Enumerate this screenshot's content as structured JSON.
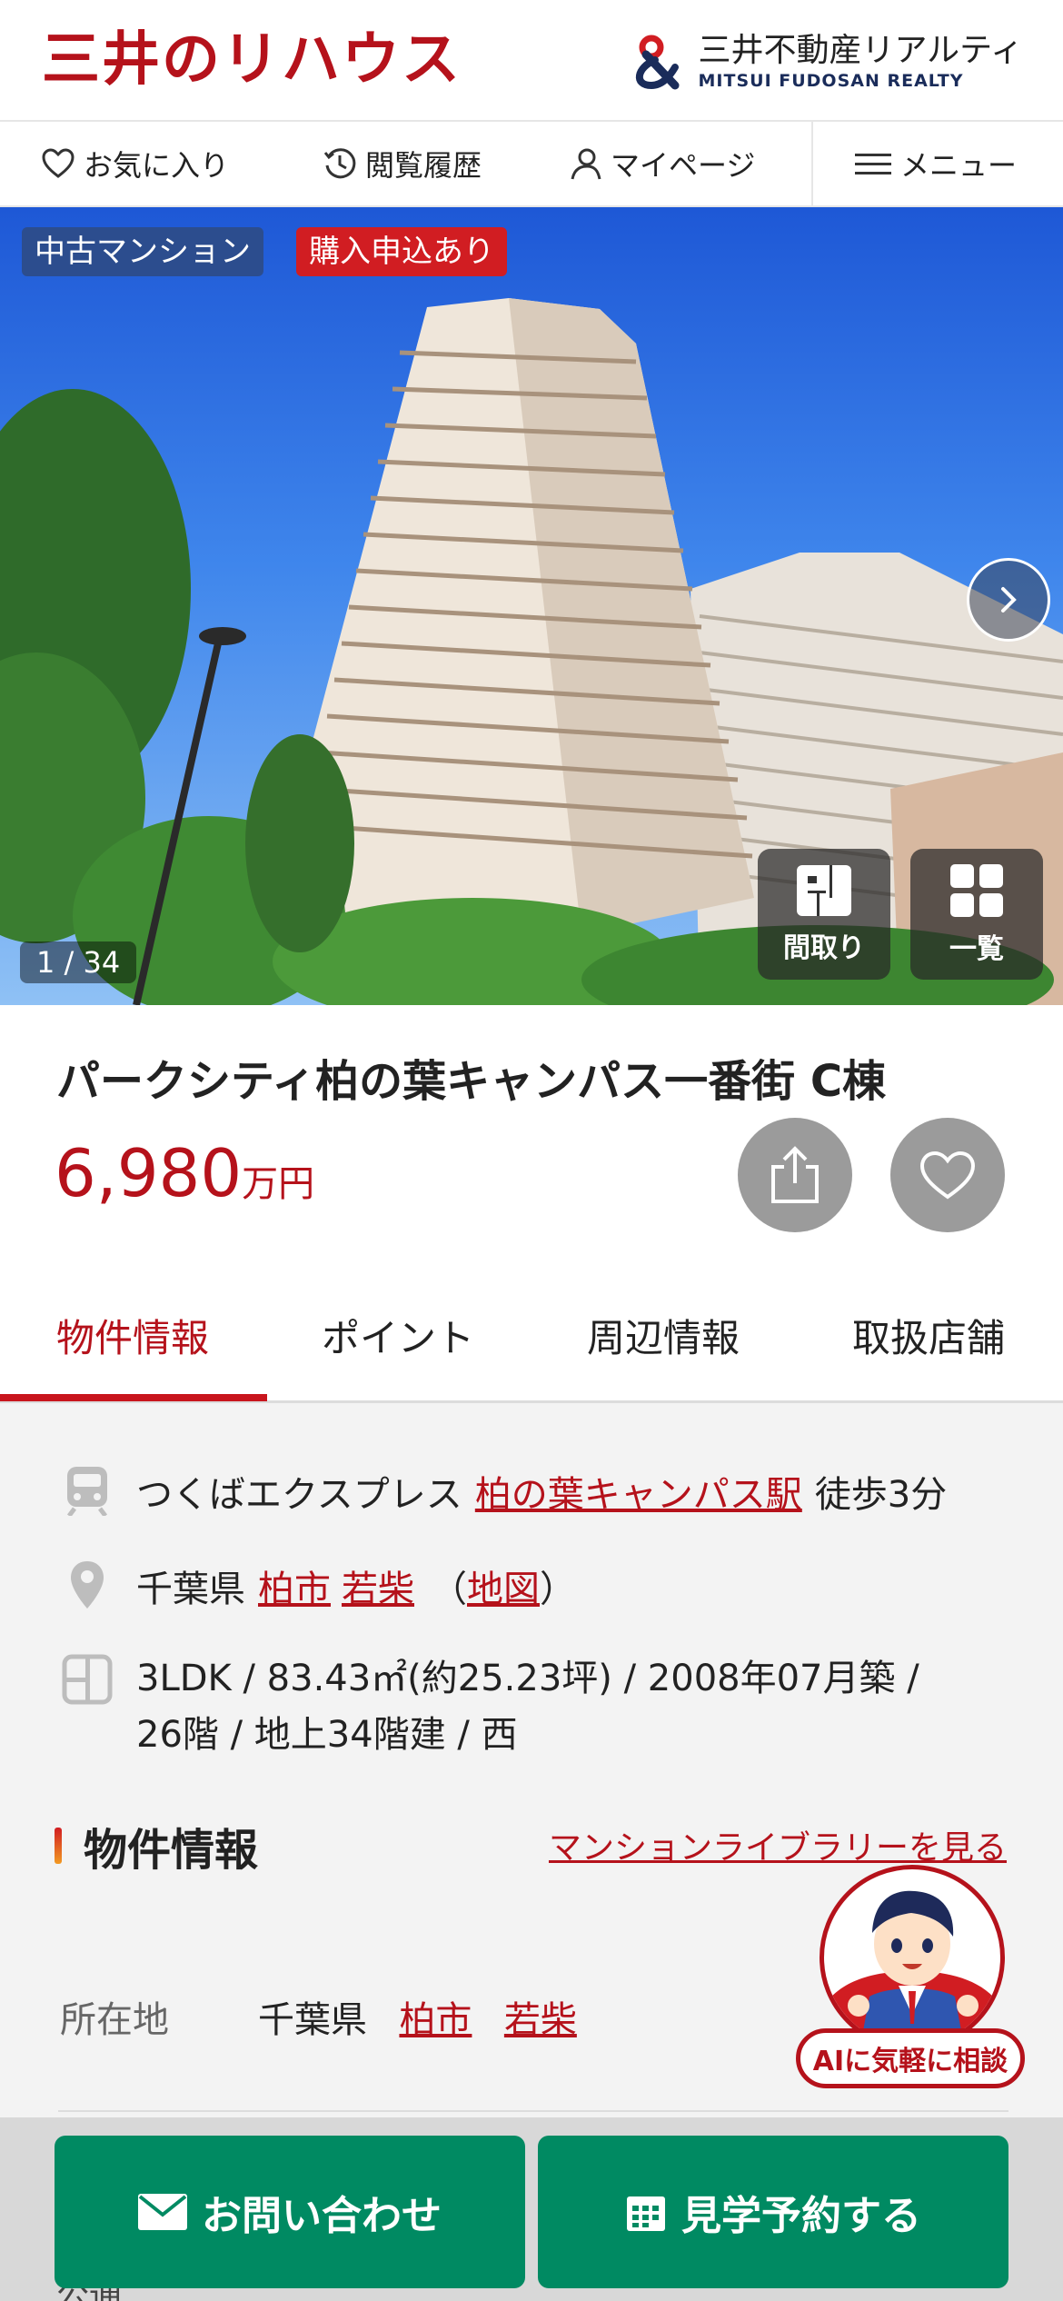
{
  "header": {
    "logo_left": "三井のリハウス",
    "logo_right_jp": "三井不動産リアルティ",
    "logo_right_en": "MITSUI FUDOSAN REALTY"
  },
  "nav": {
    "favorites": "お気に入り",
    "history": "閲覧履歴",
    "mypage": "マイページ",
    "menu": "メニュー"
  },
  "hero": {
    "tag_used": "中古マンション",
    "tag_apply": "購入申込あり",
    "counter": "1 / 34",
    "floorplan_label": "間取り",
    "list_label": "一覧"
  },
  "property": {
    "title": "パークシティ柏の葉キャンパス一番街 C棟",
    "price_value": "6,980",
    "price_unit": "万円"
  },
  "tabs": [
    {
      "label": "物件情報",
      "active": true
    },
    {
      "label": "ポイント",
      "active": false
    },
    {
      "label": "周辺情報",
      "active": false
    },
    {
      "label": "取扱店舗",
      "active": false
    }
  ],
  "access": {
    "line": "つくばエクスプレス",
    "station": "柏の葉キャンパス駅",
    "walk": "徒歩3分"
  },
  "address": {
    "prefecture": "千葉県",
    "city": "柏市",
    "town": "若柴",
    "map_open": "（",
    "map": "地図",
    "map_close": "）"
  },
  "spec": {
    "line1": "3LDK / 83.43㎡(約25.23坪) / 2008年07月築 /",
    "line2": "26階 / 地上34階建 / 西"
  },
  "section": {
    "title": "物件情報",
    "library_link": "マンションライブラリーを見る"
  },
  "detail": {
    "label": "所在地",
    "prefecture": "千葉県",
    "city": "柏市",
    "town": "若柴"
  },
  "ai": {
    "label": "AIに気軽に相談"
  },
  "cta": {
    "inquiry": "お問い合わせ",
    "visit": "見学予約する"
  },
  "peek": {
    "text": "公通"
  },
  "colors": {
    "brand_red": "#b5121b",
    "cta_green": "#008a62",
    "tag_navy": "#2c4d8e",
    "tag_red": "#d11d22"
  }
}
